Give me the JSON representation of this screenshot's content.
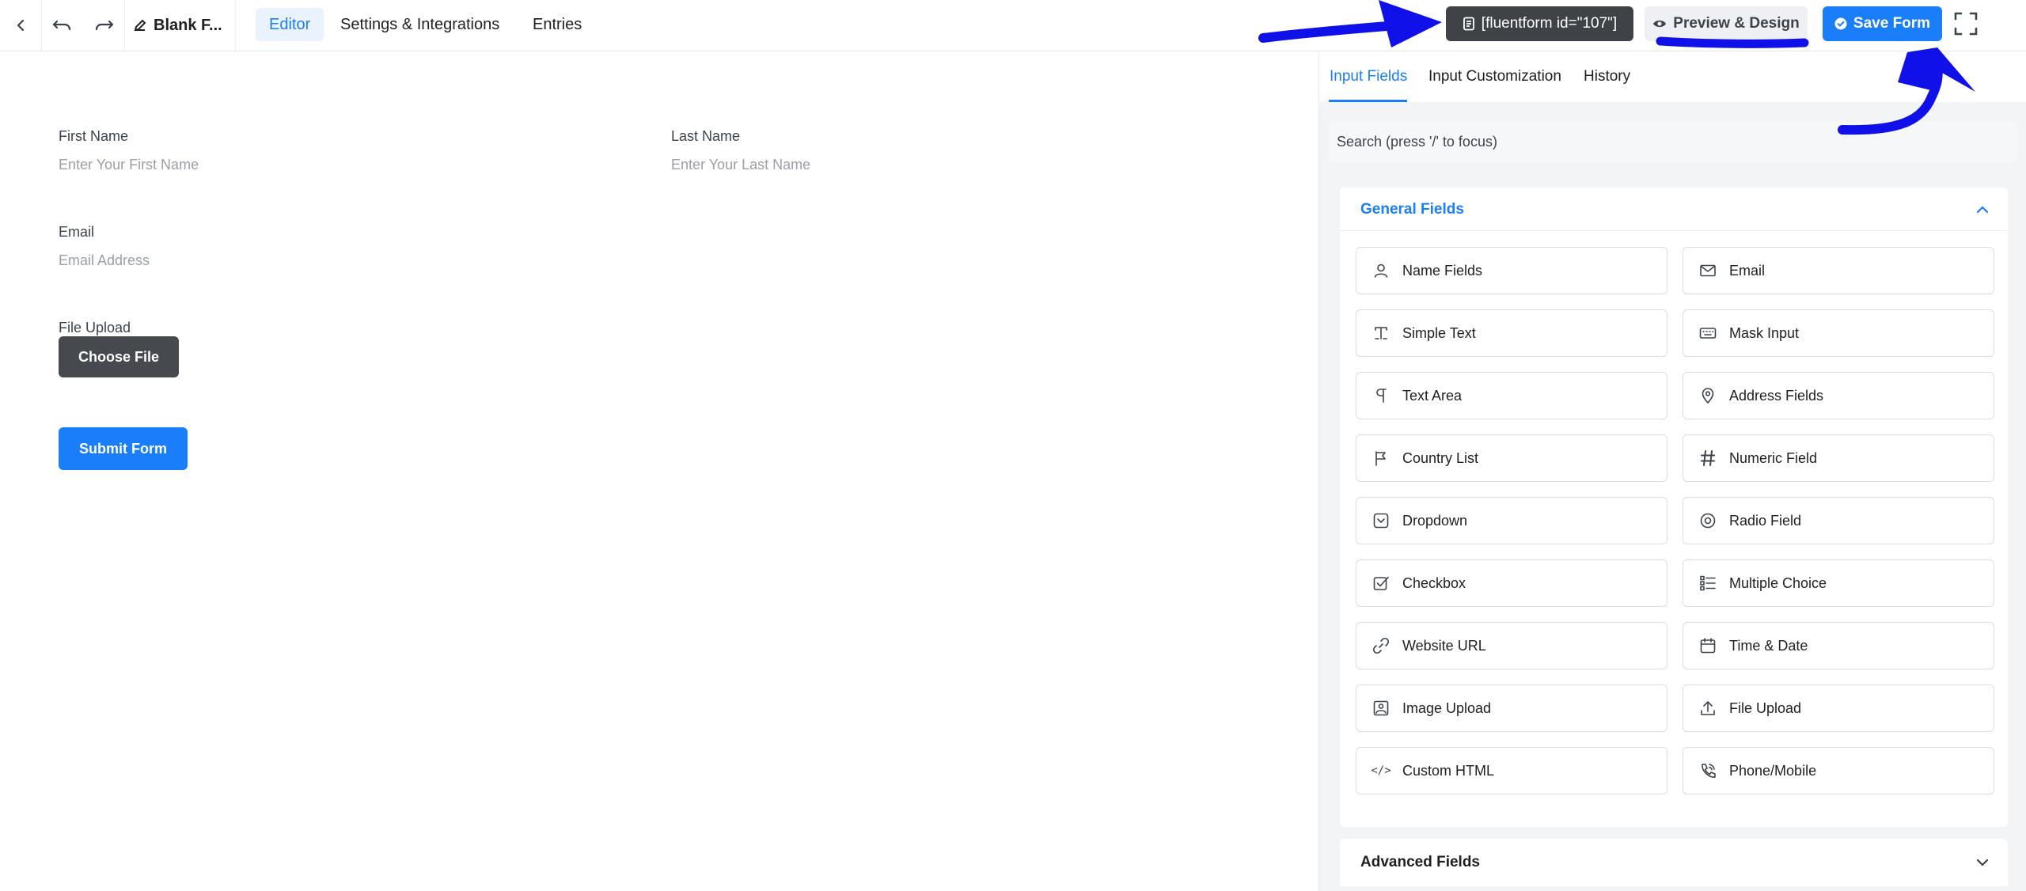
{
  "header": {
    "form_title": "Blank F...",
    "nav_tabs": [
      {
        "label": "Editor",
        "active": true
      },
      {
        "label": "Settings & Integrations",
        "active": false
      },
      {
        "label": "Entries",
        "active": false
      }
    ],
    "shortcode": "[fluentform id=\"107\"]",
    "preview_label": "Preview & Design",
    "save_label": "Save Form",
    "icons": [
      "chevron-left-icon",
      "undo-icon",
      "redo-icon",
      "pencil-icon",
      "document-icon",
      "eye-icon",
      "check-circle-icon",
      "fullscreen-icon"
    ]
  },
  "form": {
    "first_name": {
      "label": "First Name",
      "placeholder": "Enter Your First Name"
    },
    "last_name": {
      "label": "Last Name",
      "placeholder": "Enter Your Last Name"
    },
    "email": {
      "label": "Email",
      "placeholder": "Email Address"
    },
    "file_upload": {
      "label": "File Upload",
      "button": "Choose File"
    },
    "submit_label": "Submit Form"
  },
  "panel": {
    "tabs": [
      {
        "label": "Input Fields",
        "active": true
      },
      {
        "label": "Input Customization",
        "active": false
      },
      {
        "label": "History",
        "active": false
      }
    ],
    "search_placeholder": "Search (press '/' to focus)",
    "general_group": {
      "title": "General Fields",
      "expanded": true,
      "fields": [
        {
          "label": "Name Fields",
          "icon": "user-icon"
        },
        {
          "label": "Email",
          "icon": "envelope-icon"
        },
        {
          "label": "Simple Text",
          "icon": "text-cursor-icon"
        },
        {
          "label": "Mask Input",
          "icon": "keyboard-icon"
        },
        {
          "label": "Text Area",
          "icon": "paragraph-icon"
        },
        {
          "label": "Address Fields",
          "icon": "map-pin-icon"
        },
        {
          "label": "Country List",
          "icon": "flag-icon"
        },
        {
          "label": "Numeric Field",
          "icon": "hash-icon"
        },
        {
          "label": "Dropdown",
          "icon": "dropdown-icon"
        },
        {
          "label": "Radio Field",
          "icon": "radio-icon"
        },
        {
          "label": "Checkbox",
          "icon": "checkbox-icon"
        },
        {
          "label": "Multiple Choice",
          "icon": "list-icon"
        },
        {
          "label": "Website URL",
          "icon": "link-icon"
        },
        {
          "label": "Time & Date",
          "icon": "calendar-icon"
        },
        {
          "label": "Image Upload",
          "icon": "image-icon"
        },
        {
          "label": "File Upload",
          "icon": "upload-icon"
        },
        {
          "label": "Custom HTML",
          "icon": "code-icon"
        },
        {
          "label": "Phone/Mobile",
          "icon": "phone-icon"
        }
      ]
    },
    "advanced_group": {
      "title": "Advanced Fields",
      "expanded": false
    }
  },
  "colors": {
    "accent": "#1a7efb",
    "shortcode_bg": "#3f4246",
    "annotation": "#1010e8"
  }
}
